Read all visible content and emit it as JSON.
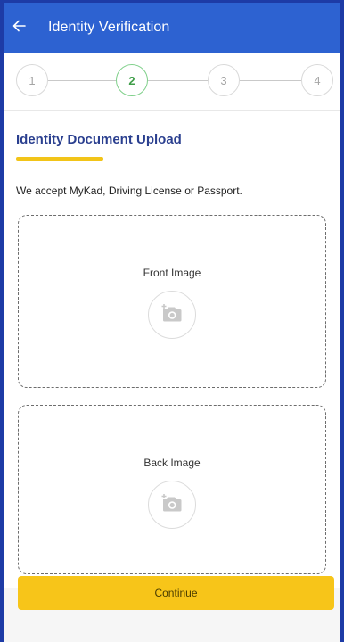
{
  "header": {
    "title": "Identity Verification",
    "back_icon": "arrow-left-icon"
  },
  "stepper": {
    "steps": [
      {
        "label": "1",
        "state": "inactive"
      },
      {
        "label": "2",
        "state": "active"
      },
      {
        "label": "3",
        "state": "inactive"
      },
      {
        "label": "4",
        "state": "inactive"
      }
    ],
    "current_step": 2
  },
  "main": {
    "section_title": "Identity Document Upload",
    "accept_text": "We accept MyKad, Driving License or Passport.",
    "uploads": {
      "front": {
        "label": "Front Image",
        "icon": "add-camera-icon"
      },
      "back": {
        "label": "Back Image",
        "icon": "add-camera-icon"
      }
    }
  },
  "footer": {
    "continue_label": "Continue"
  },
  "colors": {
    "appbar": "#2d62d1",
    "accent_yellow": "#f7c519",
    "title_blue": "#2a3f8f",
    "active_step_green": "#3f9e49"
  }
}
